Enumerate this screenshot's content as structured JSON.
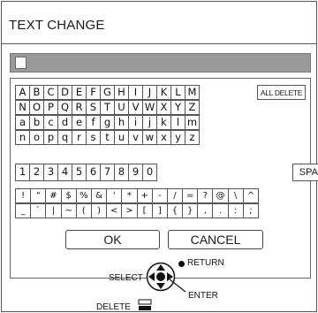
{
  "window": {
    "title": "TEXT CHANGE"
  },
  "text_field": {
    "value": ""
  },
  "keyboard": {
    "rows": [
      [
        "A",
        "B",
        "C",
        "D",
        "E",
        "F",
        "G",
        "H",
        "I",
        "J",
        "K",
        "L",
        "M"
      ],
      [
        "N",
        "O",
        "P",
        "Q",
        "R",
        "S",
        "T",
        "U",
        "V",
        "W",
        "X",
        "Y",
        "Z"
      ],
      [
        "a",
        "b",
        "c",
        "d",
        "e",
        "f",
        "g",
        "h",
        "i",
        "j",
        "k",
        "l",
        "m"
      ],
      [
        "n",
        "o",
        "p",
        "q",
        "r",
        "s",
        "t",
        "u",
        "v",
        "w",
        "x",
        "y",
        "z"
      ]
    ],
    "digits": [
      "1",
      "2",
      "3",
      "4",
      "5",
      "6",
      "7",
      "8",
      "9",
      "0"
    ],
    "space_label": "SPACE",
    "all_delete_label": "ALL DELETE",
    "symbols": [
      [
        "!",
        "\"",
        "#",
        "$",
        "%",
        "&",
        "'",
        "*",
        "+",
        "-",
        "/",
        "=",
        "?",
        "@",
        "\\",
        "^"
      ],
      [
        "_",
        "`",
        "|",
        "~",
        "(",
        ")",
        "<",
        ">",
        "[",
        "]",
        "{",
        "}",
        ",",
        ".",
        ":",
        ";"
      ]
    ]
  },
  "buttons": {
    "ok_label": "OK",
    "cancel_label": "CANCEL"
  },
  "help": {
    "select_label": "SELECT",
    "return_label": "RETURN",
    "enter_label": "ENTER",
    "delete_label": "DELETE"
  }
}
